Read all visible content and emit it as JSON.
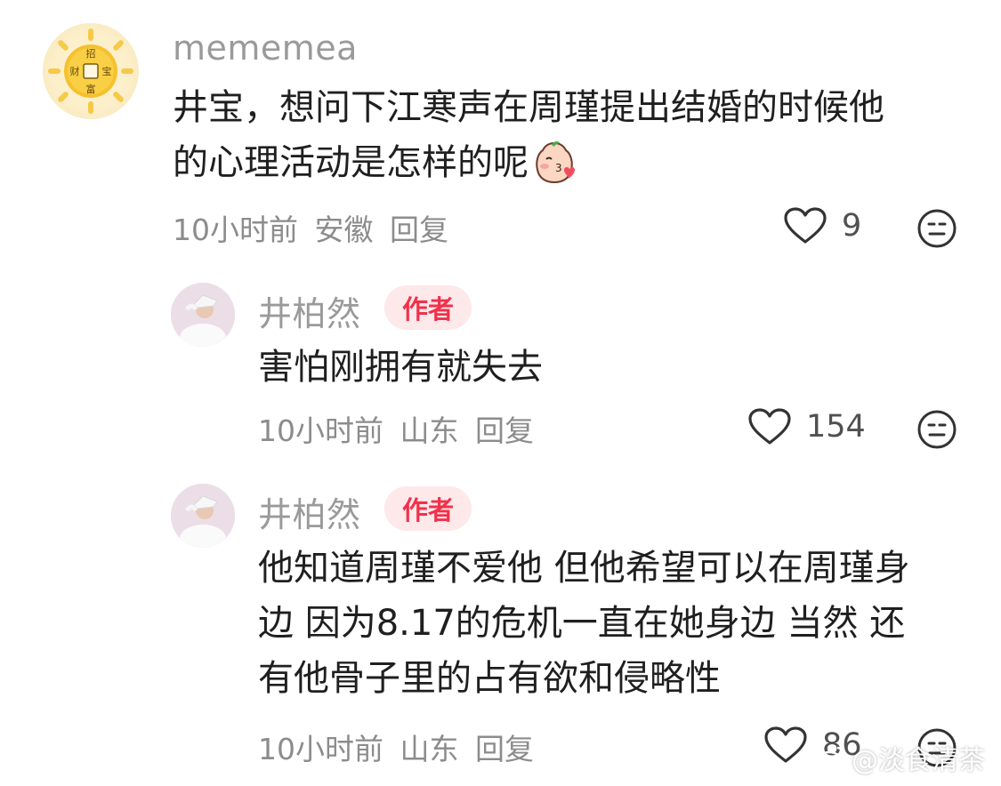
{
  "comments": [
    {
      "username": "mememea",
      "avatar_text": [
        "招",
        "财",
        "宝",
        "富"
      ],
      "text_lines": [
        "井宝，想问下江寒声在周瑾提出结婚的时候他",
        "的心理活动是怎样的呢"
      ],
      "emoji": "kiss-face-emoji",
      "time": "10小时前",
      "location": "安徽",
      "reply_label": "回复",
      "likes": "9"
    },
    {
      "username": "井柏然",
      "badge": "作者",
      "text_lines": [
        "害怕刚拥有就失去"
      ],
      "time": "10小时前",
      "location": "山东",
      "reply_label": "回复",
      "likes": "154"
    },
    {
      "username": "井柏然",
      "badge": "作者",
      "text_lines": [
        "他知道周瑾不爱他 但他希望可以在周瑾身",
        "边 因为8.17的危机一直在她身边 当然 还",
        "有他骨子里的占有欲和侵略性"
      ],
      "time": "10小时前",
      "location": "山东",
      "reply_label": "回复",
      "likes": "86"
    }
  ],
  "watermark": "@淡食清茶",
  "colors": {
    "author_badge_bg": "#fde8ea",
    "author_badge_text": "#f2314a",
    "username": "#9a9a9a",
    "meta": "#8c8c8c"
  }
}
